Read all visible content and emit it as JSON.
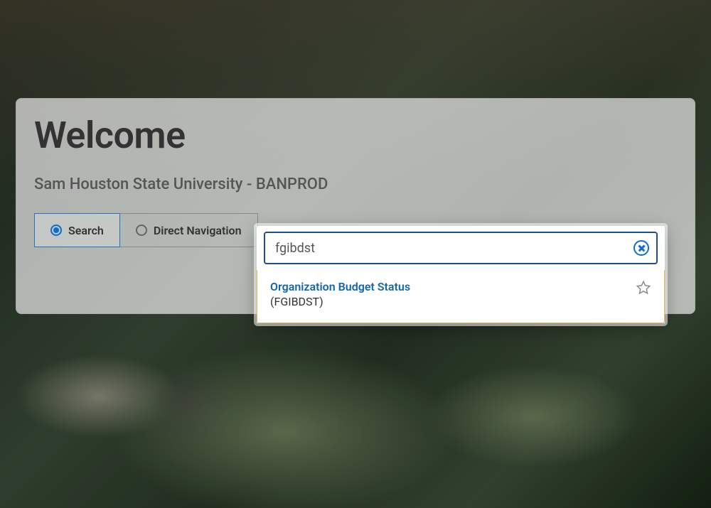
{
  "welcome": {
    "title": "Welcome",
    "subtitle": "Sam Houston State University - BANPROD"
  },
  "tabs": {
    "search": {
      "label": "Search"
    },
    "direct": {
      "label": "Direct Navigation"
    }
  },
  "search": {
    "value": "fgibdst"
  },
  "results": [
    {
      "title": "Organization Budget Status",
      "code": "(FGIBDST)"
    }
  ],
  "colors": {
    "accent_blue": "#0d6ed1",
    "border_blue": "#1b4f8e",
    "link_blue": "#1666a8",
    "highlight_border": "#e8b05a"
  }
}
